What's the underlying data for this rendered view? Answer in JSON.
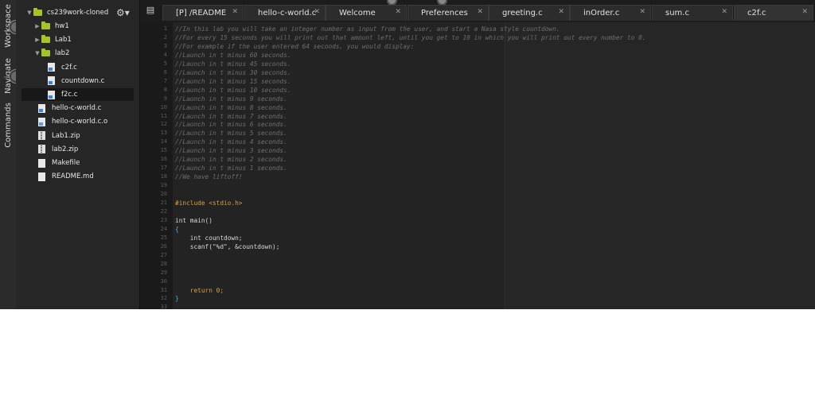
{
  "side_tabs": [
    "Workspace",
    "Navigate",
    "Commands"
  ],
  "workspace": {
    "root": "cs239work-cloned",
    "items": [
      {
        "label": "hw1",
        "type": "folder",
        "state": "collapsed",
        "depth": 1
      },
      {
        "label": "Lab1",
        "type": "folder",
        "state": "collapsed",
        "depth": 1
      },
      {
        "label": "lab2",
        "type": "folder",
        "state": "expanded",
        "depth": 1
      },
      {
        "label": "c2f.c",
        "type": "c",
        "depth": 2
      },
      {
        "label": "countdown.c",
        "type": "c",
        "depth": 2
      },
      {
        "label": "f2c.c",
        "type": "c",
        "depth": 2,
        "selected": true
      },
      {
        "label": "hello-c-world.c",
        "type": "c",
        "depth": 1
      },
      {
        "label": "hello-c-world.c.o",
        "type": "o",
        "depth": 1
      },
      {
        "label": "Lab1.zip",
        "type": "zip",
        "depth": 1
      },
      {
        "label": "lab2.zip",
        "type": "zip",
        "depth": 1
      },
      {
        "label": "Makefile",
        "type": "file",
        "depth": 1
      },
      {
        "label": "README.md",
        "type": "file",
        "depth": 1
      }
    ]
  },
  "tabs": [
    {
      "label": "[P] /README",
      "active": false
    },
    {
      "label": "hello-c-world.c",
      "active": false
    },
    {
      "label": "Welcome",
      "active": false
    },
    {
      "label": "Preferences",
      "active": false
    },
    {
      "label": "greeting.c",
      "active": false
    },
    {
      "label": "inOrder.c",
      "active": false
    },
    {
      "label": "sum.c",
      "active": false
    },
    {
      "label": "c2f.c",
      "active": true
    }
  ],
  "editor": {
    "line_numbers": [
      "1",
      "2",
      "3",
      "4",
      "5",
      "6",
      "7",
      "8",
      "9",
      "10",
      "11",
      "12",
      "13",
      "14",
      "15",
      "16",
      "17",
      "18",
      "19",
      "20",
      "21",
      "22",
      "23",
      "24",
      "25",
      "26",
      "27",
      "28",
      "29",
      "30",
      "31",
      "32",
      "33"
    ],
    "lines": [
      {
        "t": "cmt",
        "s": "//In this lab you will take an integer number as input from the user, and start a Nasa style countdown."
      },
      {
        "t": "cmt",
        "s": "//For every 15 seconds you will print out that amount left, until you get to 10 in which you will print out every number to 0."
      },
      {
        "t": "cmt",
        "s": "//For example if the user entered 64 seconds, you would display:"
      },
      {
        "t": "cmt",
        "s": "//Launch in t minus 60 seconds."
      },
      {
        "t": "cmt",
        "s": "//Launch in t minus 45 seconds."
      },
      {
        "t": "cmt",
        "s": "//Launch in t minus 30 seconds."
      },
      {
        "t": "cmt",
        "s": "//Launch in t minus 15 seconds."
      },
      {
        "t": "cmt",
        "s": "//Launch in t minus 10 seconds."
      },
      {
        "t": "cmt",
        "s": "//Launch in t minus 9 seconds."
      },
      {
        "t": "cmt",
        "s": "//Launch in t minus 8 seconds."
      },
      {
        "t": "cmt",
        "s": "//Launch in t minus 7 seconds."
      },
      {
        "t": "cmt",
        "s": "//Launch in t minus 6 seconds."
      },
      {
        "t": "cmt",
        "s": "//Launch in t minus 5 seconds."
      },
      {
        "t": "cmt",
        "s": "//Launch in t minus 4 seconds."
      },
      {
        "t": "cmt",
        "s": "//Launch in t minus 3 seconds."
      },
      {
        "t": "cmt",
        "s": "//Launch in t minus 2 seconds."
      },
      {
        "t": "cmt",
        "s": "//Launch in t minus 1 seconds."
      },
      {
        "t": "cmt",
        "s": "//We have liftoff!"
      },
      {
        "t": "plain",
        "s": ""
      },
      {
        "t": "plain",
        "s": ""
      },
      {
        "t": "pp",
        "s": "#include <stdio.h>"
      },
      {
        "t": "plain",
        "s": ""
      },
      {
        "t": "plain",
        "s": "int main()"
      },
      {
        "t": "brace",
        "s": "{"
      },
      {
        "t": "plain",
        "s": "    int countdown;"
      },
      {
        "t": "plain",
        "s": "    scanf(\"%d\", &countdown);"
      },
      {
        "t": "plain",
        "s": ""
      },
      {
        "t": "plain",
        "s": ""
      },
      {
        "t": "plain",
        "s": ""
      },
      {
        "t": "plain",
        "s": ""
      },
      {
        "t": "ret",
        "s": "    return 0;"
      },
      {
        "t": "brace",
        "s": "}"
      },
      {
        "t": "plain",
        "s": ""
      }
    ]
  }
}
